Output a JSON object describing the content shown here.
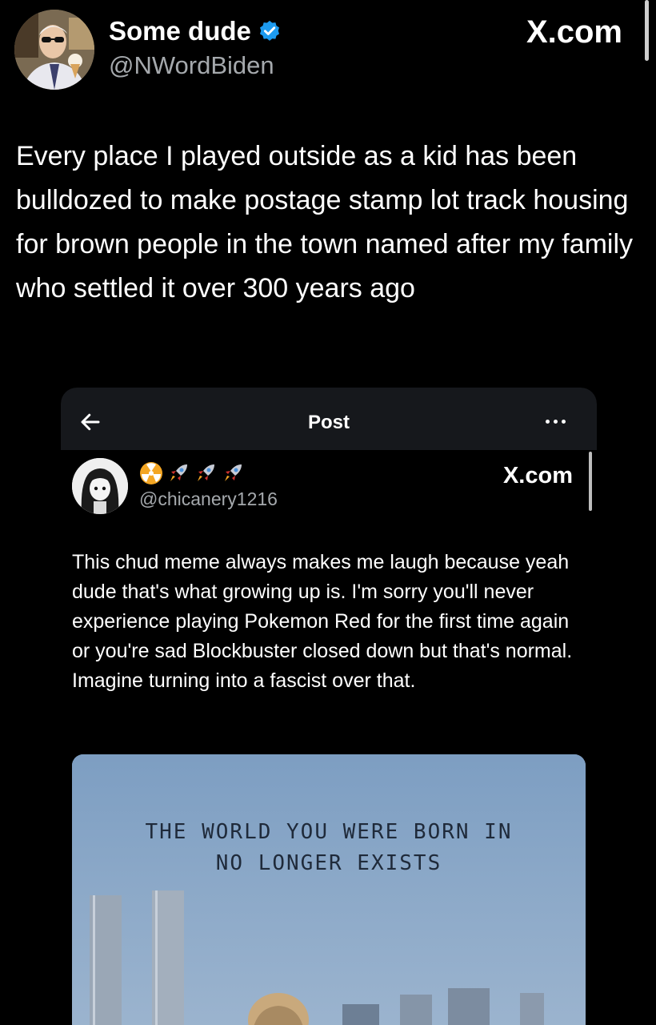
{
  "outer_tweet": {
    "display_name": "Some dude",
    "handle": "@NWordBiden",
    "site": "X.com",
    "verified_icon": "verified-badge-icon",
    "verified_color": "#1d9bf0",
    "body": "Every place I played outside as a kid has been bulldozed to make postage stamp lot track housing for brown people in the town named after my family who settled it over 300 years ago"
  },
  "embedded_screenshot": {
    "topbar": {
      "back_icon": "arrow-left-icon",
      "title": "Post",
      "more_icon": "more-dots-icon"
    },
    "author": {
      "emoji_name": "☢️🚀🚀🚀",
      "handle": "@chicanery1216",
      "site": "X.com"
    },
    "body": "This chud meme always makes me laugh because yeah dude that's what growing up is. I'm sorry you'll never experience playing Pokemon Red for the first time again or you're sad Blockbuster closed down but that's normal. Imagine turning into  a fascist over that.",
    "meme": {
      "caption_line1": "THE WORLD YOU WERE BORN IN",
      "caption_line2": "NO LONGER EXISTS"
    }
  }
}
